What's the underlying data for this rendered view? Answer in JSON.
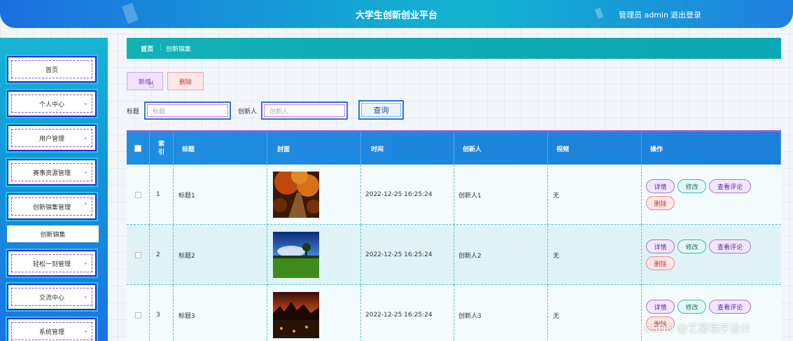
{
  "header": {
    "title": "大学生创新创业平台",
    "user_label": "管理员 admin",
    "logout_label": "退出登录"
  },
  "sidebar": {
    "items": [
      {
        "label": "首页",
        "expandable": false
      },
      {
        "label": "个人中心",
        "expandable": true
      },
      {
        "label": "用户管理",
        "expandable": true
      },
      {
        "label": "赛事资源管理",
        "expandable": true
      },
      {
        "label": "创新锦集管理",
        "expandable": true,
        "expanded": true
      },
      {
        "label": "轻松一刻管理",
        "expandable": true
      },
      {
        "label": "交流中心",
        "expandable": true
      },
      {
        "label": "系统管理",
        "expandable": true
      }
    ],
    "active_sub_item": "创新锦集"
  },
  "breadcrumb": {
    "home": "首页",
    "separator": "⋮",
    "current": "创新锦集"
  },
  "toolbar": {
    "add_label": "新增",
    "delete_label": "删除"
  },
  "search": {
    "title_label": "标题",
    "title_placeholder": "标题",
    "creator_label": "创新人",
    "creator_placeholder": "创新人",
    "button_label": "查询"
  },
  "table": {
    "columns": [
      "",
      "索引",
      "标题",
      "封面",
      "时间",
      "创新人",
      "视频",
      "操作"
    ],
    "rows": [
      {
        "index": "1",
        "title": "标题1",
        "cover": "autumn-forest-path",
        "time": "2022-12-25 16:25:24",
        "creator": "创新人1",
        "video": "无"
      },
      {
        "index": "2",
        "title": "标题2",
        "cover": "green-meadow-sky",
        "time": "2022-12-25 16:25:24",
        "creator": "创新人2",
        "video": "无"
      },
      {
        "index": "3",
        "title": "标题3",
        "cover": "sunset-field",
        "time": "2022-12-25 16:25:24",
        "creator": "创新人3",
        "video": "无"
      }
    ],
    "actions": {
      "detail": "详情",
      "edit": "修改",
      "comments": "查看评论",
      "delete": "删除"
    }
  },
  "watermark": "CSDN @艺馨程序设计"
}
